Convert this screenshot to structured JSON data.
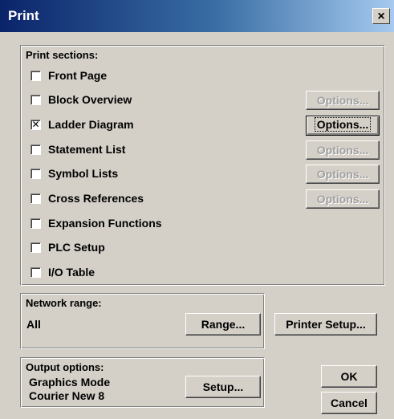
{
  "window": {
    "title": "Print",
    "close_glyph": "×"
  },
  "print_sections": {
    "title": "Print sections:",
    "items": [
      {
        "label": "Front Page",
        "checked": false
      },
      {
        "label": "Block Overview",
        "checked": false,
        "options": "Options...",
        "options_enabled": false
      },
      {
        "label": "Ladder Diagram",
        "checked": true,
        "options": "Options...",
        "options_enabled": true
      },
      {
        "label": "Statement List",
        "checked": false,
        "options": "Options...",
        "options_enabled": false
      },
      {
        "label": "Symbol Lists",
        "checked": false,
        "options": "Options...",
        "options_enabled": false
      },
      {
        "label": "Cross References",
        "checked": false,
        "options": "Options...",
        "options_enabled": false
      },
      {
        "label": "Expansion Functions",
        "checked": false
      },
      {
        "label": "PLC Setup",
        "checked": false
      },
      {
        "label": "I/O Table",
        "checked": false
      }
    ]
  },
  "network_range": {
    "title": "Network range:",
    "value": "All",
    "range_button": "Range..."
  },
  "printer_setup_button": "Printer Setup...",
  "output_options": {
    "title": "Output options:",
    "mode": "Graphics Mode",
    "font": "Courier New 8",
    "setup_button": "Setup..."
  },
  "ok_button": "OK",
  "cancel_button": "Cancel",
  "check_glyph": "✕"
}
